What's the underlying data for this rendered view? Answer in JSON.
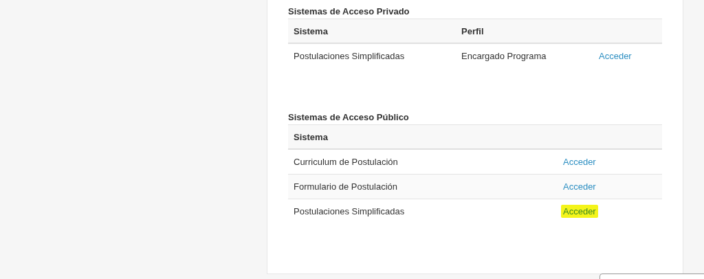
{
  "private_systems": {
    "title": "Sistemas de Acceso Privado",
    "columns": [
      "Sistema",
      "Perfil"
    ],
    "rows": [
      {
        "system": "Postulaciones Simplificadas",
        "profile": "Encargado Programa",
        "link": "Acceder",
        "highlighted": false
      }
    ]
  },
  "public_systems": {
    "title": "Sistemas de Acceso Público",
    "columns": [
      "Sistema"
    ],
    "rows": [
      {
        "system": "Curriculum de Postulación",
        "link": "Acceder",
        "highlighted": false
      },
      {
        "system": "Formulario de Postulación",
        "link": "Acceder",
        "highlighted": false
      },
      {
        "system": "Postulaciones Simplificadas",
        "link": "Acceder",
        "highlighted": true
      }
    ]
  }
}
